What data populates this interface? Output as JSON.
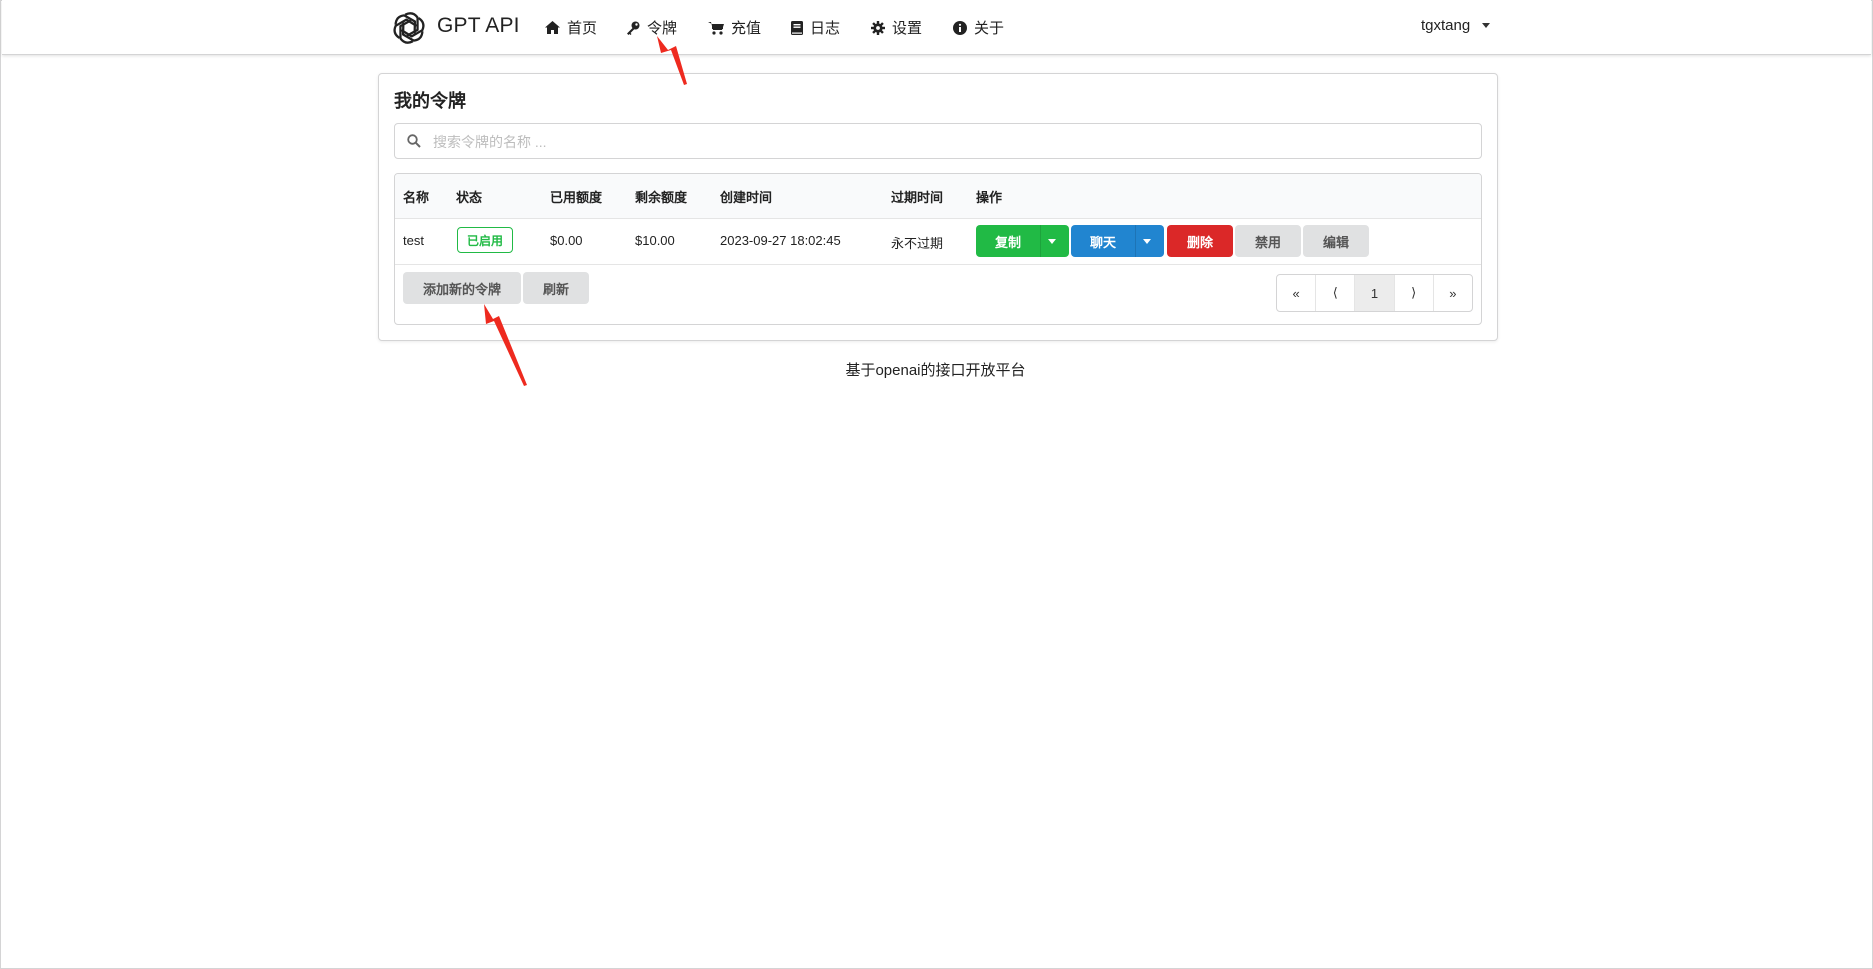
{
  "header": {
    "brand": "GPT API",
    "nav": [
      {
        "label": "首页",
        "icon": "home-icon"
      },
      {
        "label": "令牌",
        "icon": "key-icon"
      },
      {
        "label": "充值",
        "icon": "cart-icon"
      },
      {
        "label": "日志",
        "icon": "book-icon"
      },
      {
        "label": "设置",
        "icon": "gear-icon"
      },
      {
        "label": "关于",
        "icon": "info-icon"
      }
    ],
    "user": "tgxtang"
  },
  "card": {
    "title": "我的令牌",
    "search_placeholder": "搜索令牌的名称 ...",
    "columns": [
      "名称",
      "状态",
      "已用额度",
      "剩余额度",
      "创建时间",
      "过期时间",
      "操作"
    ],
    "rows": [
      {
        "name": "test",
        "status": "已启用",
        "used": "$0.00",
        "remaining": "$10.00",
        "created": "2023-09-27 18:02:45",
        "expires": "永不过期",
        "actions": {
          "copy": "复制",
          "chat": "聊天",
          "delete": "删除",
          "disable": "禁用",
          "edit": "编辑"
        }
      }
    ],
    "add_button": "添加新的令牌",
    "refresh_button": "刷新",
    "pagination": {
      "first": "«",
      "prev": "⟨",
      "current": "1",
      "next": "⟩",
      "last": "»"
    }
  },
  "footer": "基于openai的接口开放平台",
  "colors": {
    "success": "#21ba45",
    "primary": "#2185d0",
    "danger": "#db2828",
    "annotation": "#ee2a1f"
  }
}
